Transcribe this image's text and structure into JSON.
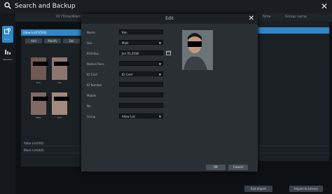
{
  "window": {
    "title": "Search and Backup"
  },
  "sidebar": {
    "items": [
      {
        "label": "Person"
      },
      {
        "label": "Statistics"
      }
    ]
  },
  "header": {
    "col1": "ID (Time/Alarm image)",
    "col2": "Nme",
    "col3": "Group name"
  },
  "left_panel": {
    "group_name": "Allow List(5/500)",
    "buttons": [
      "Add",
      "Modify",
      "Del"
    ],
    "faces": [
      {
        "caption": "Ron"
      },
      {
        "caption": "Lily"
      },
      {
        "caption": "Mike"
      },
      {
        "caption": "Tom"
      }
    ]
  },
  "list": {
    "rows": [
      {
        "name": "Allow List(0/0)"
      },
      {
        "name": "Block List(0/0)"
      }
    ]
  },
  "bottom": {
    "btn1": "Exit Import",
    "btn2": "Import to Library"
  },
  "dialog": {
    "title": "Edit",
    "fields": [
      {
        "label": "Name",
        "value": "Ron",
        "type": "text"
      },
      {
        "label": "Sex",
        "value": "Male",
        "type": "select"
      },
      {
        "label": "Birthday",
        "value": "Jan 01,2018",
        "type": "date"
      },
      {
        "label": "Native Place",
        "value": "",
        "type": "select"
      },
      {
        "label": "ID Card",
        "value": "ID Card",
        "type": "select"
      },
      {
        "label": "ID Number",
        "value": "",
        "type": "text"
      },
      {
        "label": "Mobile",
        "value": "",
        "type": "text"
      },
      {
        "label": "No.",
        "value": "",
        "type": "text"
      },
      {
        "label": "Group",
        "value": "Allow List",
        "type": "select"
      }
    ],
    "ok_label": "OK",
    "cancel_label": "Cancel"
  }
}
